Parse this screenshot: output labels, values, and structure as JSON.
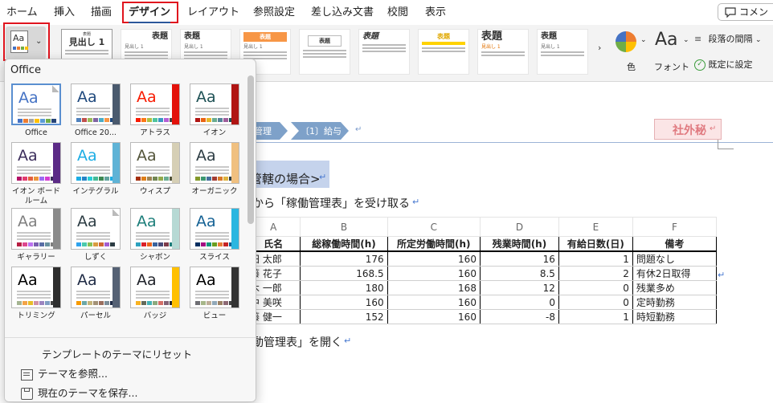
{
  "tabs": [
    {
      "label": "ホーム"
    },
    {
      "label": "挿入"
    },
    {
      "label": "描画"
    },
    {
      "label": "デザイン",
      "active": true
    },
    {
      "label": "レイアウト"
    },
    {
      "label": "参照設定"
    },
    {
      "label": "差し込み文書"
    },
    {
      "label": "校閲"
    },
    {
      "label": "表示"
    }
  ],
  "comment_label": "コメン",
  "style_gallery": [
    {
      "title": "見出し 1",
      "head": "表題",
      "sub": "見出し 1"
    },
    {
      "title": "表題",
      "sub": "見出し 1"
    },
    {
      "title": "表題",
      "sub": "見出し 1"
    },
    {
      "title": "表題",
      "sub": "見出し 1"
    },
    {
      "title": "表題",
      "sub": "見出し 1"
    },
    {
      "title": "表題",
      "sub": "見出し 1"
    },
    {
      "title": "表題",
      "sub": "見出し 1"
    },
    {
      "title": "表題",
      "sub": "見出し 1"
    },
    {
      "title": "表題",
      "sub": "見出し 1"
    }
  ],
  "ribbon_right": {
    "colors_label": "色",
    "fonts_label": "フォント",
    "fonts_glyph": "Aa",
    "paragraph_spacing_label": "段落の間隔",
    "set_default_label": "既定に設定"
  },
  "theme_panel": {
    "title": "Office",
    "themes": [
      {
        "label": "Office",
        "accent": "#4472c4",
        "sw": [
          "#4472c4",
          "#ed7d31",
          "#a5a5a5",
          "#ffc000",
          "#5b9bd5",
          "#70ad47",
          "#264478"
        ],
        "side": ""
      },
      {
        "label": "Office 20...",
        "accent": "#1f497d",
        "sw": [
          "#4f81bd",
          "#c0504d",
          "#9bbb59",
          "#8064a2",
          "#4bacc6",
          "#f79646",
          "#1f497d"
        ],
        "side": "#4a5a6e"
      },
      {
        "label": "アトラス",
        "accent": "#f81b02",
        "sw": [
          "#f81b02",
          "#fc7715",
          "#afbf41",
          "#50c49f",
          "#3b95c4",
          "#b560d4",
          "#444"
        ],
        "side": "#e3120b"
      },
      {
        "label": "イオン",
        "accent": "#1e5155",
        "sw": [
          "#b01513",
          "#ea6312",
          "#e6b729",
          "#6aac90",
          "#54849a",
          "#9e5e9b",
          "#1e5155"
        ],
        "side": "#b01513"
      },
      {
        "label": "イオン ボード\nルーム",
        "accent": "#3b2d5b",
        "sw": [
          "#b31166",
          "#e33d6f",
          "#e45f3c",
          "#e9943a",
          "#9b6bf2",
          "#d53dd0",
          "#3b2d5b"
        ],
        "side": "#5b2a86"
      },
      {
        "label": "インテグラル",
        "accent": "#1cade4",
        "sw": [
          "#1cade4",
          "#2683c6",
          "#27ced7",
          "#42ba97",
          "#3e8853",
          "#62a39f",
          "#1cade4"
        ],
        "side": "#5fb3d6"
      },
      {
        "label": "ウィスプ",
        "accent": "#53543a",
        "sw": [
          "#a53010",
          "#de7e18",
          "#9f8351",
          "#728653",
          "#92aa4c",
          "#6aac91",
          "#53543a"
        ],
        "side": "#d6cfb5"
      },
      {
        "label": "オーガニック",
        "accent": "#2c3c43",
        "sw": [
          "#83992a",
          "#3c9770",
          "#44709d",
          "#a23c33",
          "#d97828",
          "#deb340",
          "#2c3c43"
        ],
        "side": "#f0c080"
      },
      {
        "label": "ギャラリー",
        "accent": "#7f7f7f",
        "sw": [
          "#b71e42",
          "#de478e",
          "#bc72f0",
          "#795faf",
          "#586ea6",
          "#6892a0",
          "#7f7f7f"
        ],
        "side": "#8a8a8a"
      },
      {
        "label": "しずく",
        "accent": "#2c3c43",
        "sw": [
          "#2fa3ee",
          "#4bcaad",
          "#86c157",
          "#d99c3f",
          "#ce6633",
          "#a35dd1",
          "#2c3c43"
        ],
        "side": ""
      },
      {
        "label": "シャボン",
        "accent": "#1c7e7a",
        "sw": [
          "#2da2bf",
          "#da1f28",
          "#eb641b",
          "#39639d",
          "#474b78",
          "#7d3c4a",
          "#1c7e7a"
        ],
        "side": "#b6d9d4"
      },
      {
        "label": "スライス",
        "accent": "#146194",
        "sw": [
          "#052f61",
          "#a50e82",
          "#14967c",
          "#6a9e1f",
          "#e87d37",
          "#c62324",
          "#146194"
        ],
        "side": "#2bb6e0"
      },
      {
        "label": "トリミング",
        "accent": "#000000",
        "sw": [
          "#a5b592",
          "#f3a447",
          "#e7bc29",
          "#d092a7",
          "#9c85c0",
          "#809ec2",
          "#444"
        ],
        "side": "#2e2e2e"
      },
      {
        "label": "パーセル",
        "accent": "#1f2b45",
        "sw": [
          "#f79a00",
          "#6ca7a6",
          "#c5b57a",
          "#a49277",
          "#9a6f5f",
          "#7d8f9a",
          "#1f2b45"
        ],
        "side": "#556174"
      },
      {
        "label": "バッジ",
        "accent": "#22252c",
        "sw": [
          "#f8b323",
          "#656a59",
          "#46b2b5",
          "#8caa7e",
          "#d36f68",
          "#826276",
          "#22252c"
        ],
        "side": "#ffc000"
      },
      {
        "label": "ビュー",
        "accent": "#000000",
        "sw": [
          "#6f6f74",
          "#a7b789",
          "#beae98",
          "#92a9b9",
          "#9c8265",
          "#8d6974",
          "#444"
        ],
        "side": "#333"
      }
    ],
    "footer": {
      "reset_label": "テンプレートのテーマにリセット",
      "browse_label": "テーマを参照...",
      "save_label": "現在のテーマを保存..."
    }
  },
  "document": {
    "breadcrumb": [
      "管理",
      "〔1〕給与"
    ],
    "confidential": "社外秘",
    "heading_fragment": "管轄の場合>",
    "line1": "から「稼働管理表」を受け取る",
    "line2": "動管理表」を開く",
    "return_mark": "↵",
    "table": {
      "col_letters": [
        "A",
        "B",
        "C",
        "D",
        "E",
        "F"
      ],
      "headers": [
        "氏名",
        "総稼働時間(h)",
        "所定労働時間(h)",
        "残業時間(h)",
        "有給日数(日)",
        "備考"
      ],
      "rows": [
        [
          "田 太郎",
          "176",
          "160",
          "16",
          "1",
          "問題なし"
        ],
        [
          "藤 花子",
          "168.5",
          "160",
          "8.5",
          "2",
          "有休2日取得"
        ],
        [
          "木 一郎",
          "180",
          "168",
          "12",
          "0",
          "残業多め"
        ],
        [
          "中 美咲",
          "160",
          "160",
          "0",
          "0",
          "定時勤務"
        ],
        [
          "藤 健一",
          "152",
          "160",
          "-8",
          "1",
          "時短勤務"
        ]
      ]
    }
  }
}
